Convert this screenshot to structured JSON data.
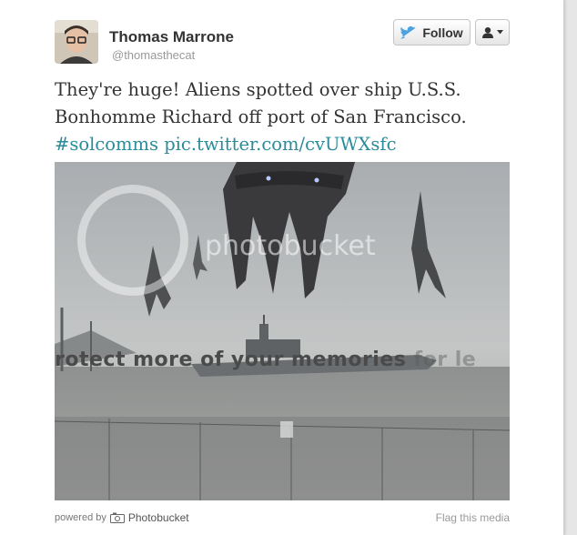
{
  "author": {
    "name": "Thomas Marrone",
    "handle": "@thomasthecat"
  },
  "actions": {
    "follow_label": "Follow",
    "user_menu_icon": "user-dropdown-icon"
  },
  "tweet": {
    "text_line1": "They're huge! Aliens spotted over ship U.S.S.",
    "text_line2": "Bonhomme Richard off port of San Francisco.",
    "hashtag": "#solcomms",
    "pic_link": "pic.twitter.com/cvUWXsfc"
  },
  "media": {
    "watermark_brand": "photobucket",
    "watermark_tagline": "rotect more of your memories",
    "watermark_tagline_faded": "for le"
  },
  "footer": {
    "powered_by": "powered by",
    "provider": "Photobucket",
    "flag_label": "Flag this media"
  },
  "colors": {
    "link": "#2a8c99",
    "twitter_bird": "#4aa3df"
  }
}
